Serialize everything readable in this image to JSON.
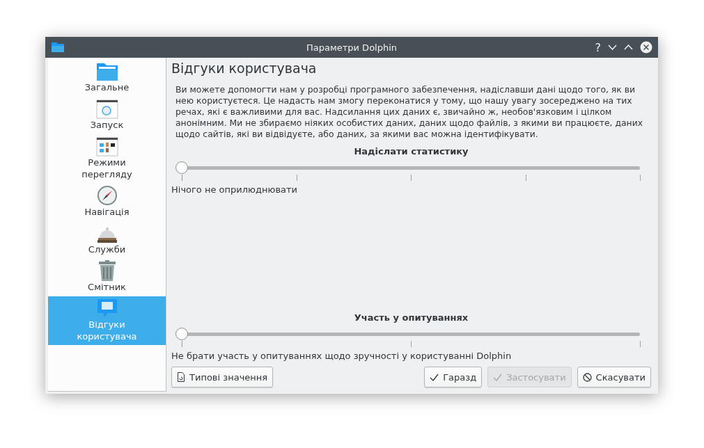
{
  "window": {
    "title": "Параметри Dolphin"
  },
  "title_buttons": [
    "?"
  ],
  "sidebar": {
    "items": [
      {
        "label": "Загальне",
        "selected": false
      },
      {
        "label": "Запуск",
        "selected": false
      },
      {
        "label": "Режими перегляду",
        "selected": false
      },
      {
        "label": "Навігація",
        "selected": false
      },
      {
        "label": "Служби",
        "selected": false
      },
      {
        "label": "Смітник",
        "selected": false
      },
      {
        "label": "Відгуки користувача",
        "selected": true
      }
    ]
  },
  "page": {
    "title": "Відгуки користувача",
    "description": "Ви можете допомогти нам у розробці програмного забезпечення, надіславши дані щодо того, як ви нею користуєтеся. Це надасть нам змогу переконатися у тому, що нашу увагу зосереджено на тих речах, які є важливими для вас. Надсилання цих даних є, звичайно ж, необов'язковим і цілком анонімним. Ми не збираємо ніяких особистих даних, даних щодо файлів, з якими ви працюєте, даних щодо сайтів, які ви відвідуєте, або даних, за якими вас можна ідентифікувати.",
    "sliders": [
      {
        "label": "Надіслати статистику",
        "kind": "five-step",
        "level": 0,
        "caption": "Нічого не оприлюднювати"
      },
      {
        "label": "Участь у опитуваннях",
        "kind": "three-step",
        "level": 0,
        "caption": "Не брати участь у опитуваннях щодо зручності у користуванні Dolphin"
      }
    ]
  },
  "buttons": [
    {
      "label": "Типові значення",
      "kind": "defaults",
      "disabled": false
    },
    {
      "label": "Гаразд",
      "kind": "confirm",
      "disabled": false
    },
    {
      "label": "Застосувати",
      "kind": "confirm",
      "disabled": true
    },
    {
      "label": "Скасувати",
      "kind": "cancel",
      "disabled": false
    }
  ]
}
